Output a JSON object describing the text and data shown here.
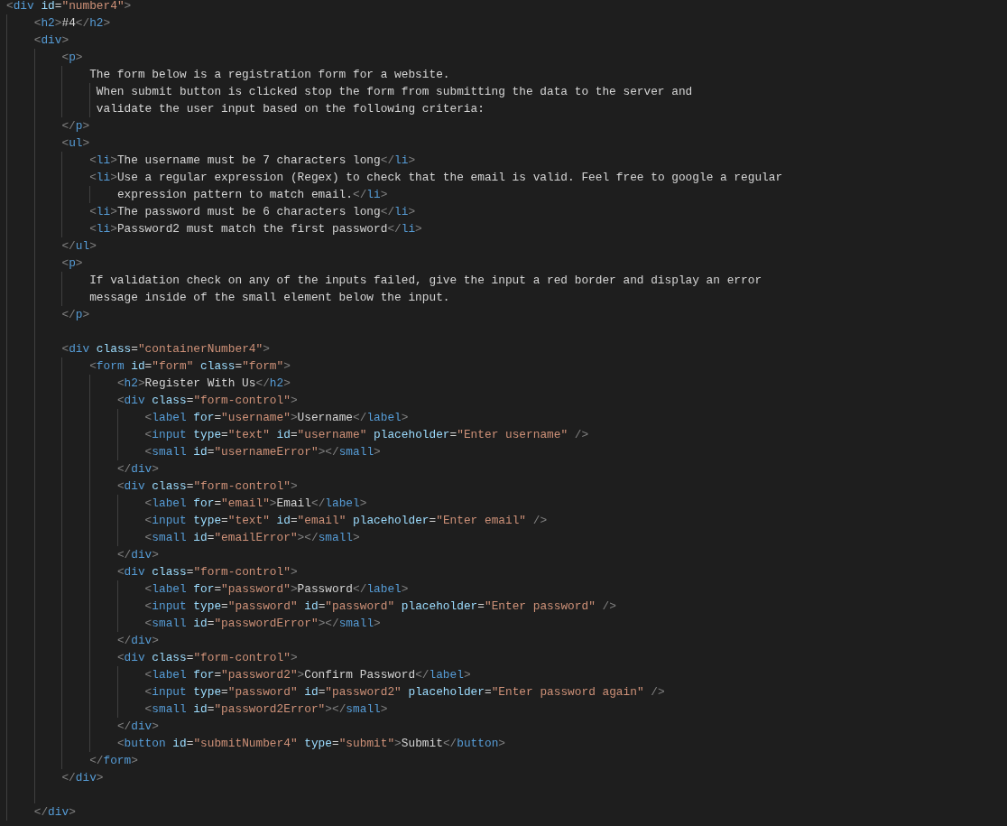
{
  "editor": {
    "lines": [
      {
        "tokens": [
          {
            "kind": "bracket",
            "text": "<"
          },
          {
            "kind": "tag",
            "text": "div"
          },
          {
            "kind": "attr",
            "text": " id"
          },
          {
            "kind": "equals",
            "text": "="
          },
          {
            "kind": "string",
            "text": "\"number4\""
          },
          {
            "kind": "bracket",
            "text": ">"
          }
        ]
      },
      {
        "tokens": [
          {
            "kind": "bracket",
            "text": "    <"
          },
          {
            "kind": "tag",
            "text": "h2"
          },
          {
            "kind": "bracket",
            "text": ">"
          },
          {
            "kind": "text",
            "text": "#4"
          },
          {
            "kind": "bracket",
            "text": "</"
          },
          {
            "kind": "tag",
            "text": "h2"
          },
          {
            "kind": "bracket",
            "text": ">"
          }
        ]
      },
      {
        "tokens": [
          {
            "kind": "bracket",
            "text": "    <"
          },
          {
            "kind": "tag",
            "text": "div"
          },
          {
            "kind": "bracket",
            "text": ">"
          }
        ]
      },
      {
        "tokens": [
          {
            "kind": "bracket",
            "text": "        <"
          },
          {
            "kind": "tag",
            "text": "p"
          },
          {
            "kind": "bracket",
            "text": ">"
          }
        ]
      },
      {
        "tokens": [
          {
            "kind": "text",
            "text": "            The form below is a registration form for a website."
          }
        ]
      },
      {
        "tokens": [
          {
            "kind": "text",
            "text": "             When submit button is clicked stop the form from submitting the data to the server and"
          }
        ]
      },
      {
        "tokens": [
          {
            "kind": "text",
            "text": "             validate the user input based on the following criteria:"
          }
        ]
      },
      {
        "tokens": [
          {
            "kind": "bracket",
            "text": "        </"
          },
          {
            "kind": "tag",
            "text": "p"
          },
          {
            "kind": "bracket",
            "text": ">"
          }
        ]
      },
      {
        "tokens": [
          {
            "kind": "bracket",
            "text": "        <"
          },
          {
            "kind": "tag",
            "text": "ul"
          },
          {
            "kind": "bracket",
            "text": ">"
          }
        ]
      },
      {
        "tokens": [
          {
            "kind": "bracket",
            "text": "            <"
          },
          {
            "kind": "tag",
            "text": "li"
          },
          {
            "kind": "bracket",
            "text": ">"
          },
          {
            "kind": "text",
            "text": "The username must be 7 characters long"
          },
          {
            "kind": "bracket",
            "text": "</"
          },
          {
            "kind": "tag",
            "text": "li"
          },
          {
            "kind": "bracket",
            "text": ">"
          }
        ]
      },
      {
        "tokens": [
          {
            "kind": "bracket",
            "text": "            <"
          },
          {
            "kind": "tag",
            "text": "li"
          },
          {
            "kind": "bracket",
            "text": ">"
          },
          {
            "kind": "text",
            "text": "Use a regular expression (Regex) to check that the email is valid. Feel free to google a regular"
          }
        ]
      },
      {
        "tokens": [
          {
            "kind": "text",
            "text": "                expression pattern to match email."
          },
          {
            "kind": "bracket",
            "text": "</"
          },
          {
            "kind": "tag",
            "text": "li"
          },
          {
            "kind": "bracket",
            "text": ">"
          }
        ]
      },
      {
        "tokens": [
          {
            "kind": "bracket",
            "text": "            <"
          },
          {
            "kind": "tag",
            "text": "li"
          },
          {
            "kind": "bracket",
            "text": ">"
          },
          {
            "kind": "text",
            "text": "The password must be 6 characters long"
          },
          {
            "kind": "bracket",
            "text": "</"
          },
          {
            "kind": "tag",
            "text": "li"
          },
          {
            "kind": "bracket",
            "text": ">"
          }
        ]
      },
      {
        "tokens": [
          {
            "kind": "bracket",
            "text": "            <"
          },
          {
            "kind": "tag",
            "text": "li"
          },
          {
            "kind": "bracket",
            "text": ">"
          },
          {
            "kind": "text",
            "text": "Password2 must match the first password"
          },
          {
            "kind": "bracket",
            "text": "</"
          },
          {
            "kind": "tag",
            "text": "li"
          },
          {
            "kind": "bracket",
            "text": ">"
          }
        ]
      },
      {
        "tokens": [
          {
            "kind": "bracket",
            "text": "        </"
          },
          {
            "kind": "tag",
            "text": "ul"
          },
          {
            "kind": "bracket",
            "text": ">"
          }
        ]
      },
      {
        "tokens": [
          {
            "kind": "bracket",
            "text": "        <"
          },
          {
            "kind": "tag",
            "text": "p"
          },
          {
            "kind": "bracket",
            "text": ">"
          }
        ]
      },
      {
        "tokens": [
          {
            "kind": "text",
            "text": "            If validation check on any of the inputs failed, give the input a red border and display an error"
          }
        ]
      },
      {
        "tokens": [
          {
            "kind": "text",
            "text": "            message inside of the small element below the input."
          }
        ]
      },
      {
        "tokens": [
          {
            "kind": "bracket",
            "text": "        </"
          },
          {
            "kind": "tag",
            "text": "p"
          },
          {
            "kind": "bracket",
            "text": ">"
          }
        ]
      },
      {
        "blank_before": true,
        "tokens": [
          {
            "kind": "bracket",
            "text": "        <"
          },
          {
            "kind": "tag",
            "text": "div"
          },
          {
            "kind": "attr",
            "text": " class"
          },
          {
            "kind": "equals",
            "text": "="
          },
          {
            "kind": "string",
            "text": "\"containerNumber4\""
          },
          {
            "kind": "bracket",
            "text": ">"
          }
        ]
      },
      {
        "tokens": [
          {
            "kind": "bracket",
            "text": "            <"
          },
          {
            "kind": "tag",
            "text": "form"
          },
          {
            "kind": "attr",
            "text": " id"
          },
          {
            "kind": "equals",
            "text": "="
          },
          {
            "kind": "string",
            "text": "\"form\""
          },
          {
            "kind": "attr",
            "text": " class"
          },
          {
            "kind": "equals",
            "text": "="
          },
          {
            "kind": "string",
            "text": "\"form\""
          },
          {
            "kind": "bracket",
            "text": ">"
          }
        ]
      },
      {
        "tokens": [
          {
            "kind": "bracket",
            "text": "                <"
          },
          {
            "kind": "tag",
            "text": "h2"
          },
          {
            "kind": "bracket",
            "text": ">"
          },
          {
            "kind": "text",
            "text": "Register With Us"
          },
          {
            "kind": "bracket",
            "text": "</"
          },
          {
            "kind": "tag",
            "text": "h2"
          },
          {
            "kind": "bracket",
            "text": ">"
          }
        ]
      },
      {
        "tokens": [
          {
            "kind": "bracket",
            "text": "                <"
          },
          {
            "kind": "tag",
            "text": "div"
          },
          {
            "kind": "attr",
            "text": " class"
          },
          {
            "kind": "equals",
            "text": "="
          },
          {
            "kind": "string",
            "text": "\"form-control\""
          },
          {
            "kind": "bracket",
            "text": ">"
          }
        ]
      },
      {
        "tokens": [
          {
            "kind": "bracket",
            "text": "                    <"
          },
          {
            "kind": "tag",
            "text": "label"
          },
          {
            "kind": "attr",
            "text": " for"
          },
          {
            "kind": "equals",
            "text": "="
          },
          {
            "kind": "string",
            "text": "\"username\""
          },
          {
            "kind": "bracket",
            "text": ">"
          },
          {
            "kind": "text",
            "text": "Username"
          },
          {
            "kind": "bracket",
            "text": "</"
          },
          {
            "kind": "tag",
            "text": "label"
          },
          {
            "kind": "bracket",
            "text": ">"
          }
        ]
      },
      {
        "tokens": [
          {
            "kind": "bracket",
            "text": "                    <"
          },
          {
            "kind": "tag",
            "text": "input"
          },
          {
            "kind": "attr",
            "text": " type"
          },
          {
            "kind": "equals",
            "text": "="
          },
          {
            "kind": "string",
            "text": "\"text\""
          },
          {
            "kind": "attr",
            "text": " id"
          },
          {
            "kind": "equals",
            "text": "="
          },
          {
            "kind": "string",
            "text": "\"username\""
          },
          {
            "kind": "attr",
            "text": " placeholder"
          },
          {
            "kind": "equals",
            "text": "="
          },
          {
            "kind": "string",
            "text": "\"Enter username\""
          },
          {
            "kind": "bracket",
            "text": " />"
          }
        ]
      },
      {
        "tokens": [
          {
            "kind": "bracket",
            "text": "                    <"
          },
          {
            "kind": "tag",
            "text": "small"
          },
          {
            "kind": "attr",
            "text": " id"
          },
          {
            "kind": "equals",
            "text": "="
          },
          {
            "kind": "string",
            "text": "\"usernameError\""
          },
          {
            "kind": "bracket",
            "text": "></"
          },
          {
            "kind": "tag",
            "text": "small"
          },
          {
            "kind": "bracket",
            "text": ">"
          }
        ]
      },
      {
        "tokens": [
          {
            "kind": "bracket",
            "text": "                </"
          },
          {
            "kind": "tag",
            "text": "div"
          },
          {
            "kind": "bracket",
            "text": ">"
          }
        ]
      },
      {
        "tokens": [
          {
            "kind": "bracket",
            "text": "                <"
          },
          {
            "kind": "tag",
            "text": "div"
          },
          {
            "kind": "attr",
            "text": " class"
          },
          {
            "kind": "equals",
            "text": "="
          },
          {
            "kind": "string",
            "text": "\"form-control\""
          },
          {
            "kind": "bracket",
            "text": ">"
          }
        ]
      },
      {
        "tokens": [
          {
            "kind": "bracket",
            "text": "                    <"
          },
          {
            "kind": "tag",
            "text": "label"
          },
          {
            "kind": "attr",
            "text": " for"
          },
          {
            "kind": "equals",
            "text": "="
          },
          {
            "kind": "string",
            "text": "\"email\""
          },
          {
            "kind": "bracket",
            "text": ">"
          },
          {
            "kind": "text",
            "text": "Email"
          },
          {
            "kind": "bracket",
            "text": "</"
          },
          {
            "kind": "tag",
            "text": "label"
          },
          {
            "kind": "bracket",
            "text": ">"
          }
        ]
      },
      {
        "tokens": [
          {
            "kind": "bracket",
            "text": "                    <"
          },
          {
            "kind": "tag",
            "text": "input"
          },
          {
            "kind": "attr",
            "text": " type"
          },
          {
            "kind": "equals",
            "text": "="
          },
          {
            "kind": "string",
            "text": "\"text\""
          },
          {
            "kind": "attr",
            "text": " id"
          },
          {
            "kind": "equals",
            "text": "="
          },
          {
            "kind": "string",
            "text": "\"email\""
          },
          {
            "kind": "attr",
            "text": " placeholder"
          },
          {
            "kind": "equals",
            "text": "="
          },
          {
            "kind": "string",
            "text": "\"Enter email\""
          },
          {
            "kind": "bracket",
            "text": " />"
          }
        ]
      },
      {
        "tokens": [
          {
            "kind": "bracket",
            "text": "                    <"
          },
          {
            "kind": "tag",
            "text": "small"
          },
          {
            "kind": "attr",
            "text": " id"
          },
          {
            "kind": "equals",
            "text": "="
          },
          {
            "kind": "string",
            "text": "\"emailError\""
          },
          {
            "kind": "bracket",
            "text": "></"
          },
          {
            "kind": "tag",
            "text": "small"
          },
          {
            "kind": "bracket",
            "text": ">"
          }
        ]
      },
      {
        "tokens": [
          {
            "kind": "bracket",
            "text": "                </"
          },
          {
            "kind": "tag",
            "text": "div"
          },
          {
            "kind": "bracket",
            "text": ">"
          }
        ]
      },
      {
        "tokens": [
          {
            "kind": "bracket",
            "text": "                <"
          },
          {
            "kind": "tag",
            "text": "div"
          },
          {
            "kind": "attr",
            "text": " class"
          },
          {
            "kind": "equals",
            "text": "="
          },
          {
            "kind": "string",
            "text": "\"form-control\""
          },
          {
            "kind": "bracket",
            "text": ">"
          }
        ]
      },
      {
        "tokens": [
          {
            "kind": "bracket",
            "text": "                    <"
          },
          {
            "kind": "tag",
            "text": "label"
          },
          {
            "kind": "attr",
            "text": " for"
          },
          {
            "kind": "equals",
            "text": "="
          },
          {
            "kind": "string",
            "text": "\"password\""
          },
          {
            "kind": "bracket",
            "text": ">"
          },
          {
            "kind": "text",
            "text": "Password"
          },
          {
            "kind": "bracket",
            "text": "</"
          },
          {
            "kind": "tag",
            "text": "label"
          },
          {
            "kind": "bracket",
            "text": ">"
          }
        ]
      },
      {
        "tokens": [
          {
            "kind": "bracket",
            "text": "                    <"
          },
          {
            "kind": "tag",
            "text": "input"
          },
          {
            "kind": "attr",
            "text": " type"
          },
          {
            "kind": "equals",
            "text": "="
          },
          {
            "kind": "string",
            "text": "\"password\""
          },
          {
            "kind": "attr",
            "text": " id"
          },
          {
            "kind": "equals",
            "text": "="
          },
          {
            "kind": "string",
            "text": "\"password\""
          },
          {
            "kind": "attr",
            "text": " placeholder"
          },
          {
            "kind": "equals",
            "text": "="
          },
          {
            "kind": "string",
            "text": "\"Enter password\""
          },
          {
            "kind": "bracket",
            "text": " />"
          }
        ]
      },
      {
        "tokens": [
          {
            "kind": "bracket",
            "text": "                    <"
          },
          {
            "kind": "tag",
            "text": "small"
          },
          {
            "kind": "attr",
            "text": " id"
          },
          {
            "kind": "equals",
            "text": "="
          },
          {
            "kind": "string",
            "text": "\"passwordError\""
          },
          {
            "kind": "bracket",
            "text": "></"
          },
          {
            "kind": "tag",
            "text": "small"
          },
          {
            "kind": "bracket",
            "text": ">"
          }
        ]
      },
      {
        "tokens": [
          {
            "kind": "bracket",
            "text": "                </"
          },
          {
            "kind": "tag",
            "text": "div"
          },
          {
            "kind": "bracket",
            "text": ">"
          }
        ]
      },
      {
        "tokens": [
          {
            "kind": "bracket",
            "text": "                <"
          },
          {
            "kind": "tag",
            "text": "div"
          },
          {
            "kind": "attr",
            "text": " class"
          },
          {
            "kind": "equals",
            "text": "="
          },
          {
            "kind": "string",
            "text": "\"form-control\""
          },
          {
            "kind": "bracket",
            "text": ">"
          }
        ]
      },
      {
        "tokens": [
          {
            "kind": "bracket",
            "text": "                    <"
          },
          {
            "kind": "tag",
            "text": "label"
          },
          {
            "kind": "attr",
            "text": " for"
          },
          {
            "kind": "equals",
            "text": "="
          },
          {
            "kind": "string",
            "text": "\"password2\""
          },
          {
            "kind": "bracket",
            "text": ">"
          },
          {
            "kind": "text",
            "text": "Confirm Password"
          },
          {
            "kind": "bracket",
            "text": "</"
          },
          {
            "kind": "tag",
            "text": "label"
          },
          {
            "kind": "bracket",
            "text": ">"
          }
        ]
      },
      {
        "tokens": [
          {
            "kind": "bracket",
            "text": "                    <"
          },
          {
            "kind": "tag",
            "text": "input"
          },
          {
            "kind": "attr",
            "text": " type"
          },
          {
            "kind": "equals",
            "text": "="
          },
          {
            "kind": "string",
            "text": "\"password\""
          },
          {
            "kind": "attr",
            "text": " id"
          },
          {
            "kind": "equals",
            "text": "="
          },
          {
            "kind": "string",
            "text": "\"password2\""
          },
          {
            "kind": "attr",
            "text": " placeholder"
          },
          {
            "kind": "equals",
            "text": "="
          },
          {
            "kind": "string",
            "text": "\"Enter password again\""
          },
          {
            "kind": "bracket",
            "text": " />"
          }
        ]
      },
      {
        "tokens": [
          {
            "kind": "bracket",
            "text": "                    <"
          },
          {
            "kind": "tag",
            "text": "small"
          },
          {
            "kind": "attr",
            "text": " id"
          },
          {
            "kind": "equals",
            "text": "="
          },
          {
            "kind": "string",
            "text": "\"password2Error\""
          },
          {
            "kind": "bracket",
            "text": "></"
          },
          {
            "kind": "tag",
            "text": "small"
          },
          {
            "kind": "bracket",
            "text": ">"
          }
        ]
      },
      {
        "tokens": [
          {
            "kind": "bracket",
            "text": "                </"
          },
          {
            "kind": "tag",
            "text": "div"
          },
          {
            "kind": "bracket",
            "text": ">"
          }
        ]
      },
      {
        "tokens": [
          {
            "kind": "bracket",
            "text": "                <"
          },
          {
            "kind": "tag",
            "text": "button"
          },
          {
            "kind": "attr",
            "text": " id"
          },
          {
            "kind": "equals",
            "text": "="
          },
          {
            "kind": "string",
            "text": "\"submitNumber4\""
          },
          {
            "kind": "attr",
            "text": " type"
          },
          {
            "kind": "equals",
            "text": "="
          },
          {
            "kind": "string",
            "text": "\"submit\""
          },
          {
            "kind": "bracket",
            "text": ">"
          },
          {
            "kind": "text",
            "text": "Submit"
          },
          {
            "kind": "bracket",
            "text": "</"
          },
          {
            "kind": "tag",
            "text": "button"
          },
          {
            "kind": "bracket",
            "text": ">"
          }
        ]
      },
      {
        "tokens": [
          {
            "kind": "bracket",
            "text": "            </"
          },
          {
            "kind": "tag",
            "text": "form"
          },
          {
            "kind": "bracket",
            "text": ">"
          }
        ]
      },
      {
        "tokens": [
          {
            "kind": "bracket",
            "text": "        </"
          },
          {
            "kind": "tag",
            "text": "div"
          },
          {
            "kind": "bracket",
            "text": ">"
          }
        ]
      },
      {
        "blank_before": true,
        "tokens": [
          {
            "kind": "bracket",
            "text": "    </"
          },
          {
            "kind": "tag",
            "text": "div"
          },
          {
            "kind": "bracket",
            "text": ">"
          }
        ]
      }
    ]
  }
}
